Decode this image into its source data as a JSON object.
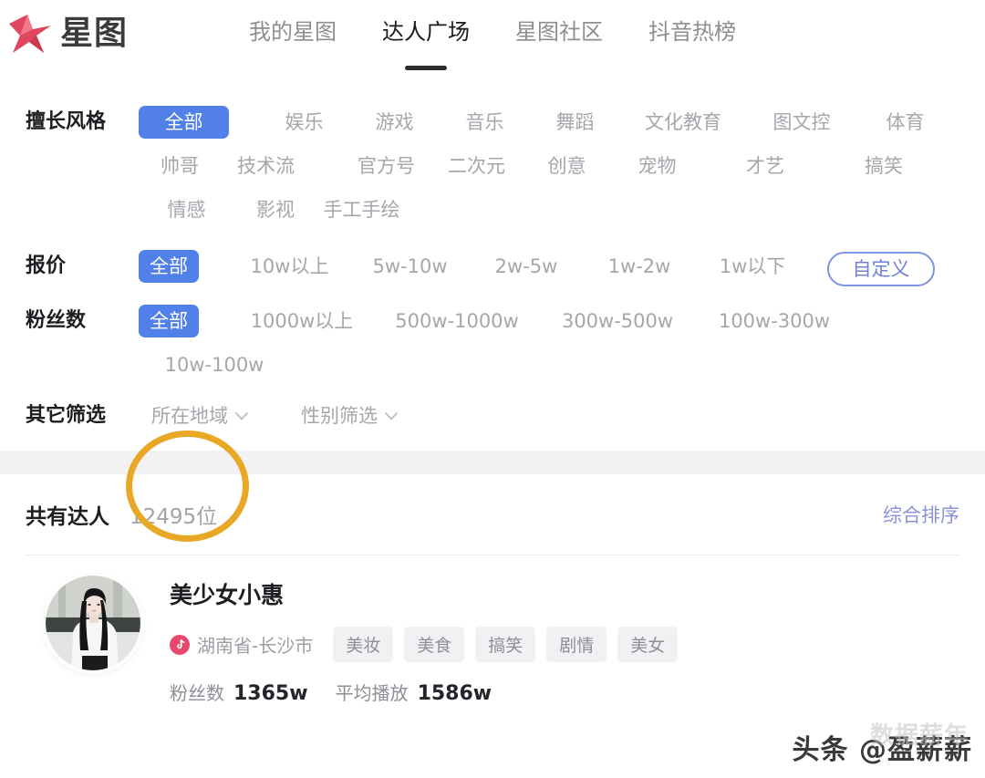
{
  "brand": {
    "logo_icon": "star-logo-icon",
    "name": "星图"
  },
  "nav": {
    "items": [
      {
        "label": "我的星图",
        "active": false
      },
      {
        "label": "达人广场",
        "active": true
      },
      {
        "label": "星图社区",
        "active": false
      },
      {
        "label": "抖音热榜",
        "active": false
      }
    ]
  },
  "filters": [
    {
      "key": "style",
      "label": "擅长风格",
      "options": [
        "全部",
        "娱乐",
        "游戏",
        "音乐",
        "舞蹈",
        "文化教育",
        "图文控",
        "体育",
        "帅哥",
        "技术流",
        "官方号",
        "二次元",
        "创意",
        "宠物",
        "才艺",
        "搞笑",
        "情感",
        "影视",
        "手工手绘"
      ],
      "selected": "全部"
    },
    {
      "key": "price",
      "label": "报价",
      "options": [
        "全部",
        "10w以上",
        "5w-10w",
        "2w-5w",
        "1w-2w",
        "1w以下"
      ],
      "selected": "全部",
      "custom_label": "自定义"
    },
    {
      "key": "fans",
      "label": "粉丝数",
      "options": [
        "全部",
        "1000w以上",
        "500w-1000w",
        "300w-500w",
        "100w-300w",
        "10w-100w"
      ],
      "selected": "全部"
    }
  ],
  "other_filters": {
    "label": "其它筛选",
    "dropdowns": [
      {
        "label": "所在地域",
        "icon": "chevron-down-icon"
      },
      {
        "label": "性别筛选",
        "icon": "chevron-down-icon"
      }
    ]
  },
  "results": {
    "title": "共有达人",
    "count": "12495位",
    "sort_label": "综合排序",
    "annotation_color": "#e8a725"
  },
  "creator": {
    "avatar_icon": "creator-avatar",
    "name": "美少女小惠",
    "platform_icon": "douyin-icon",
    "location": "湖南省-长沙市",
    "tags": [
      "美妆",
      "美食",
      "搞笑",
      "剧情",
      "美女"
    ],
    "stats": [
      {
        "label": "粉丝数",
        "value": "1365w"
      },
      {
        "label": "平均播放",
        "value": "1586w"
      }
    ]
  },
  "watermark": {
    "text": "头条 @盈薪薪",
    "ghost_text": "数据薪年"
  },
  "colors": {
    "accent_blue": "#5180e8",
    "outline_blue": "#7f94e0",
    "sort_blue": "#8b93d6",
    "annotation_gold": "#e8a725",
    "brand_pink": "#e0465f",
    "muted_text": "#a6a6ad"
  }
}
